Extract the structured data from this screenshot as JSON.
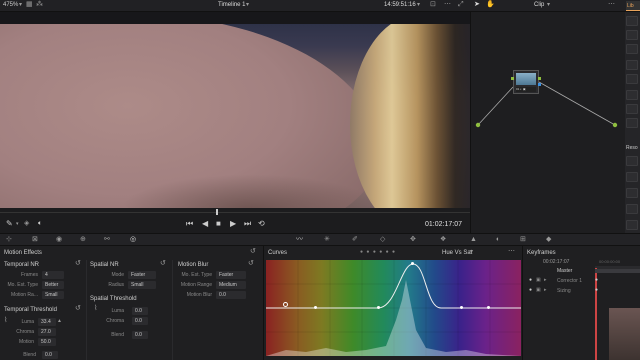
{
  "topbar": {
    "zoom": "475%",
    "timeline_title": "Timeline 1",
    "timecode": "14:59:51:16",
    "node_mode": "Clip",
    "right_tab": "Lib"
  },
  "viewer": {
    "timecode": "01:02:17:07"
  },
  "right_strip": {
    "section_label": "Reso"
  },
  "motion_effects": {
    "title": "Motion Effects",
    "temporal_nr": {
      "title": "Temporal NR",
      "frames_label": "Frames",
      "frames_value": "4",
      "mo_est_type_label": "Mo. Est. Type",
      "mo_est_type_value": "Better",
      "motion_range_label": "Motion Ra...",
      "motion_range_value": "Small"
    },
    "temporal_threshold": {
      "title": "Temporal Threshold",
      "luma_label": "Luma",
      "luma_value": "33.4",
      "chroma_label": "Chroma",
      "chroma_value": "27.0",
      "motion_label": "Motion",
      "motion_value": "50.0",
      "blend_label": "Blend",
      "blend_value": "0.0"
    },
    "spatial_nr": {
      "title": "Spatial NR",
      "mode_label": "Mode",
      "mode_value": "Faster",
      "radius_label": "Radius",
      "radius_value": "Small"
    },
    "spatial_threshold": {
      "title": "Spatial Threshold",
      "luma_label": "Luma",
      "luma_value": "0.0",
      "chroma_label": "Chroma",
      "chroma_value": "0.0",
      "blend_label": "Blend",
      "blend_value": "0.0"
    },
    "motion_blur": {
      "title": "Motion Blur",
      "mo_est_type_label": "Mo. Est. Type",
      "mo_est_type_value": "Faster",
      "motion_range_label": "Motion Range",
      "motion_range_value": "Medium",
      "motion_blur_label": "Motion Blur",
      "motion_blur_value": "0.0"
    }
  },
  "curves": {
    "title": "Curves",
    "mode": "Hue Vs Sat"
  },
  "keyframes": {
    "title": "Keyframes",
    "timecode": "00:02:17:07",
    "ruler_timecode": "00:00:00:00",
    "rows": [
      {
        "label": "Master"
      },
      {
        "label": "Corrector 1"
      },
      {
        "label": "Sizing"
      }
    ]
  },
  "colors": {
    "accent": "#e8a35c",
    "panel_bg": "#1f1f21",
    "text": "#c8c8c8"
  }
}
